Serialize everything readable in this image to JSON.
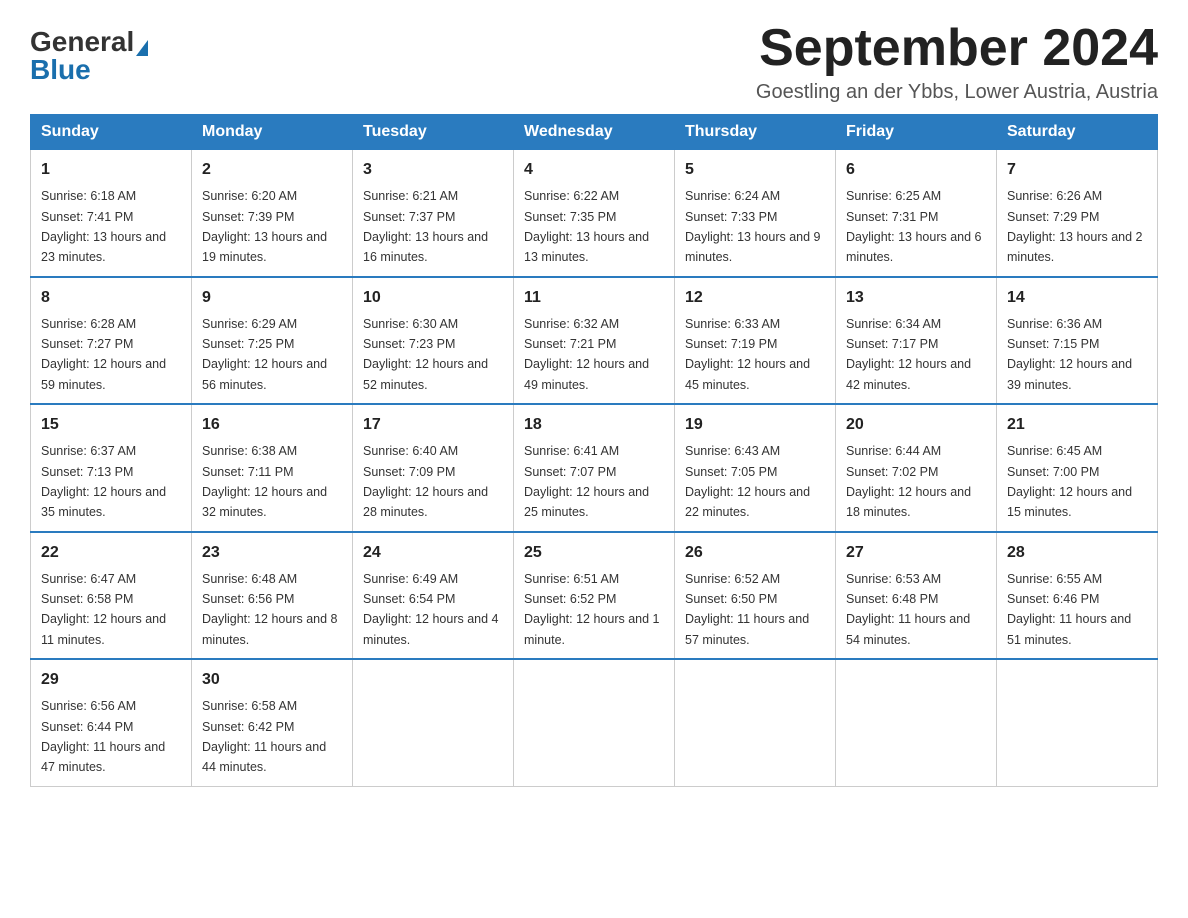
{
  "header": {
    "logo_general": "General",
    "logo_blue": "Blue",
    "month_title": "September 2024",
    "subtitle": "Goestling an der Ybbs, Lower Austria, Austria"
  },
  "weekdays": [
    "Sunday",
    "Monday",
    "Tuesday",
    "Wednesday",
    "Thursday",
    "Friday",
    "Saturday"
  ],
  "weeks": [
    [
      {
        "day": "1",
        "sunrise": "6:18 AM",
        "sunset": "7:41 PM",
        "daylight": "13 hours and 23 minutes."
      },
      {
        "day": "2",
        "sunrise": "6:20 AM",
        "sunset": "7:39 PM",
        "daylight": "13 hours and 19 minutes."
      },
      {
        "day": "3",
        "sunrise": "6:21 AM",
        "sunset": "7:37 PM",
        "daylight": "13 hours and 16 minutes."
      },
      {
        "day": "4",
        "sunrise": "6:22 AM",
        "sunset": "7:35 PM",
        "daylight": "13 hours and 13 minutes."
      },
      {
        "day": "5",
        "sunrise": "6:24 AM",
        "sunset": "7:33 PM",
        "daylight": "13 hours and 9 minutes."
      },
      {
        "day": "6",
        "sunrise": "6:25 AM",
        "sunset": "7:31 PM",
        "daylight": "13 hours and 6 minutes."
      },
      {
        "day": "7",
        "sunrise": "6:26 AM",
        "sunset": "7:29 PM",
        "daylight": "13 hours and 2 minutes."
      }
    ],
    [
      {
        "day": "8",
        "sunrise": "6:28 AM",
        "sunset": "7:27 PM",
        "daylight": "12 hours and 59 minutes."
      },
      {
        "day": "9",
        "sunrise": "6:29 AM",
        "sunset": "7:25 PM",
        "daylight": "12 hours and 56 minutes."
      },
      {
        "day": "10",
        "sunrise": "6:30 AM",
        "sunset": "7:23 PM",
        "daylight": "12 hours and 52 minutes."
      },
      {
        "day": "11",
        "sunrise": "6:32 AM",
        "sunset": "7:21 PM",
        "daylight": "12 hours and 49 minutes."
      },
      {
        "day": "12",
        "sunrise": "6:33 AM",
        "sunset": "7:19 PM",
        "daylight": "12 hours and 45 minutes."
      },
      {
        "day": "13",
        "sunrise": "6:34 AM",
        "sunset": "7:17 PM",
        "daylight": "12 hours and 42 minutes."
      },
      {
        "day": "14",
        "sunrise": "6:36 AM",
        "sunset": "7:15 PM",
        "daylight": "12 hours and 39 minutes."
      }
    ],
    [
      {
        "day": "15",
        "sunrise": "6:37 AM",
        "sunset": "7:13 PM",
        "daylight": "12 hours and 35 minutes."
      },
      {
        "day": "16",
        "sunrise": "6:38 AM",
        "sunset": "7:11 PM",
        "daylight": "12 hours and 32 minutes."
      },
      {
        "day": "17",
        "sunrise": "6:40 AM",
        "sunset": "7:09 PM",
        "daylight": "12 hours and 28 minutes."
      },
      {
        "day": "18",
        "sunrise": "6:41 AM",
        "sunset": "7:07 PM",
        "daylight": "12 hours and 25 minutes."
      },
      {
        "day": "19",
        "sunrise": "6:43 AM",
        "sunset": "7:05 PM",
        "daylight": "12 hours and 22 minutes."
      },
      {
        "day": "20",
        "sunrise": "6:44 AM",
        "sunset": "7:02 PM",
        "daylight": "12 hours and 18 minutes."
      },
      {
        "day": "21",
        "sunrise": "6:45 AM",
        "sunset": "7:00 PM",
        "daylight": "12 hours and 15 minutes."
      }
    ],
    [
      {
        "day": "22",
        "sunrise": "6:47 AM",
        "sunset": "6:58 PM",
        "daylight": "12 hours and 11 minutes."
      },
      {
        "day": "23",
        "sunrise": "6:48 AM",
        "sunset": "6:56 PM",
        "daylight": "12 hours and 8 minutes."
      },
      {
        "day": "24",
        "sunrise": "6:49 AM",
        "sunset": "6:54 PM",
        "daylight": "12 hours and 4 minutes."
      },
      {
        "day": "25",
        "sunrise": "6:51 AM",
        "sunset": "6:52 PM",
        "daylight": "12 hours and 1 minute."
      },
      {
        "day": "26",
        "sunrise": "6:52 AM",
        "sunset": "6:50 PM",
        "daylight": "11 hours and 57 minutes."
      },
      {
        "day": "27",
        "sunrise": "6:53 AM",
        "sunset": "6:48 PM",
        "daylight": "11 hours and 54 minutes."
      },
      {
        "day": "28",
        "sunrise": "6:55 AM",
        "sunset": "6:46 PM",
        "daylight": "11 hours and 51 minutes."
      }
    ],
    [
      {
        "day": "29",
        "sunrise": "6:56 AM",
        "sunset": "6:44 PM",
        "daylight": "11 hours and 47 minutes."
      },
      {
        "day": "30",
        "sunrise": "6:58 AM",
        "sunset": "6:42 PM",
        "daylight": "11 hours and 44 minutes."
      },
      null,
      null,
      null,
      null,
      null
    ]
  ]
}
